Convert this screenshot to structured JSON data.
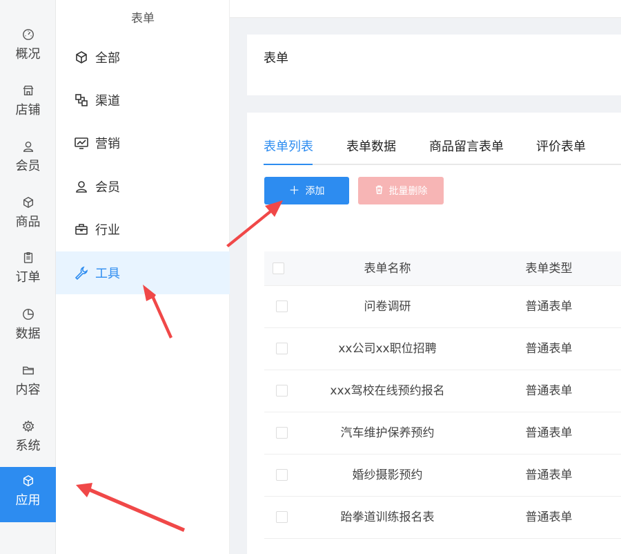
{
  "rail": {
    "items": [
      {
        "label": "概况",
        "icon": "gauge-icon"
      },
      {
        "label": "店铺",
        "icon": "store-icon"
      },
      {
        "label": "会员",
        "icon": "user-icon"
      },
      {
        "label": "商品",
        "icon": "box-icon"
      },
      {
        "label": "订单",
        "icon": "clipboard-icon"
      },
      {
        "label": "数据",
        "icon": "pie-icon"
      },
      {
        "label": "内容",
        "icon": "folder-icon"
      },
      {
        "label": "系统",
        "icon": "gear-icon"
      },
      {
        "label": "应用",
        "icon": "cube-icon"
      }
    ],
    "active_index": 8
  },
  "subnav": {
    "title": "表单",
    "items": [
      {
        "label": "全部",
        "icon": "cube-icon"
      },
      {
        "label": "渠道",
        "icon": "channel-icon"
      },
      {
        "label": "营销",
        "icon": "chart-monitor-icon"
      },
      {
        "label": "会员",
        "icon": "user-icon"
      },
      {
        "label": "行业",
        "icon": "briefcase-icon"
      },
      {
        "label": "工具",
        "icon": "wrench-icon"
      }
    ],
    "active_index": 5
  },
  "header": {
    "title": "表单"
  },
  "tabs": [
    {
      "label": "表单列表"
    },
    {
      "label": "表单数据"
    },
    {
      "label": "商品留言表单"
    },
    {
      "label": "评价表单"
    }
  ],
  "toolbar": {
    "add_label": "添加",
    "batch_delete_label": "批量删除"
  },
  "table": {
    "columns": [
      "表单名称",
      "表单类型"
    ],
    "rows": [
      {
        "name": "问卷调研",
        "type": "普通表单"
      },
      {
        "name": "xx公司xx职位招聘",
        "type": "普通表单"
      },
      {
        "name": "xxx驾校在线预约报名",
        "type": "普通表单"
      },
      {
        "name": "汽车维护保养预约",
        "type": "普通表单"
      },
      {
        "name": "婚纱摄影预约",
        "type": "普通表单"
      },
      {
        "name": "跆拳道训练报名表",
        "type": "普通表单"
      }
    ]
  },
  "colors": {
    "accent": "#2d8cf0",
    "danger_disabled": "#f7b5b5",
    "annotation_arrow": "#f04848"
  }
}
